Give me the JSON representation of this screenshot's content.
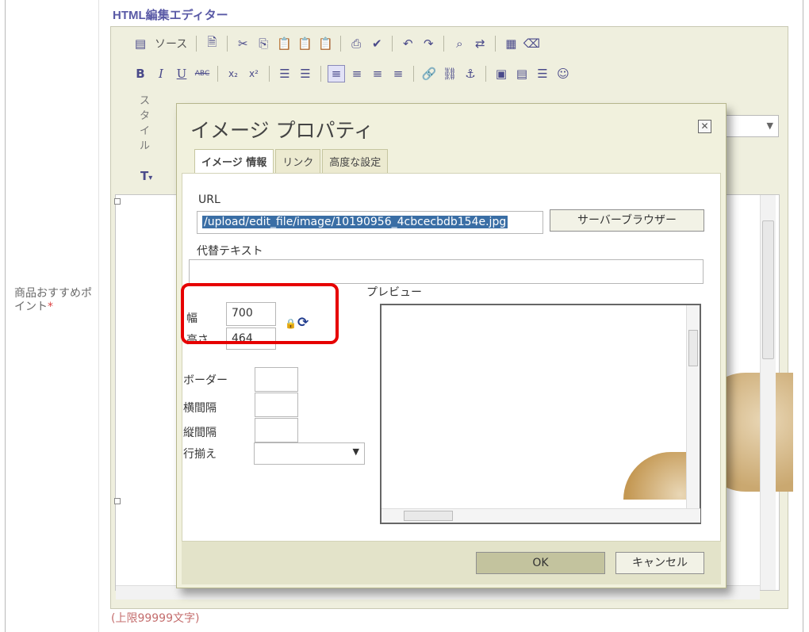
{
  "form": {
    "field_label": "商品おすすめポイント",
    "required_mark": "*",
    "limit_text": "(上限99999文字)"
  },
  "editor": {
    "title": "HTML編集エディター",
    "toolbar1": {
      "source_label": "ソース"
    },
    "toolbar2": {
      "bold": "B",
      "italic": "I",
      "underline": "U",
      "strike": "ABC",
      "sub": "x₂",
      "sup": "x²"
    },
    "style_vertical": [
      "ス",
      "タ",
      "イ",
      "ル"
    ],
    "text_color_button": "T"
  },
  "dialog": {
    "title": "イメージ プロパティ",
    "tabs": [
      {
        "label": "イメージ 情報"
      },
      {
        "label": "リンク"
      },
      {
        "label": "高度な設定"
      }
    ],
    "url_label": "URL",
    "url_value": "/upload/edit_file/image/10190956_4cbcecbdb154e.jpg",
    "server_browser": "サーバーブラウザー",
    "alt_label": "代替テキスト",
    "alt_value": "",
    "width_label": "幅",
    "width_value": "700",
    "height_label": "高さ",
    "height_value": "464",
    "border_label": "ボーダー",
    "hspace_label": "横間隔",
    "vspace_label": "縦間隔",
    "align_label": "行揃え",
    "align_value": "",
    "preview_label": "プレビュー",
    "ok_label": "OK",
    "cancel_label": "キャンセル"
  }
}
